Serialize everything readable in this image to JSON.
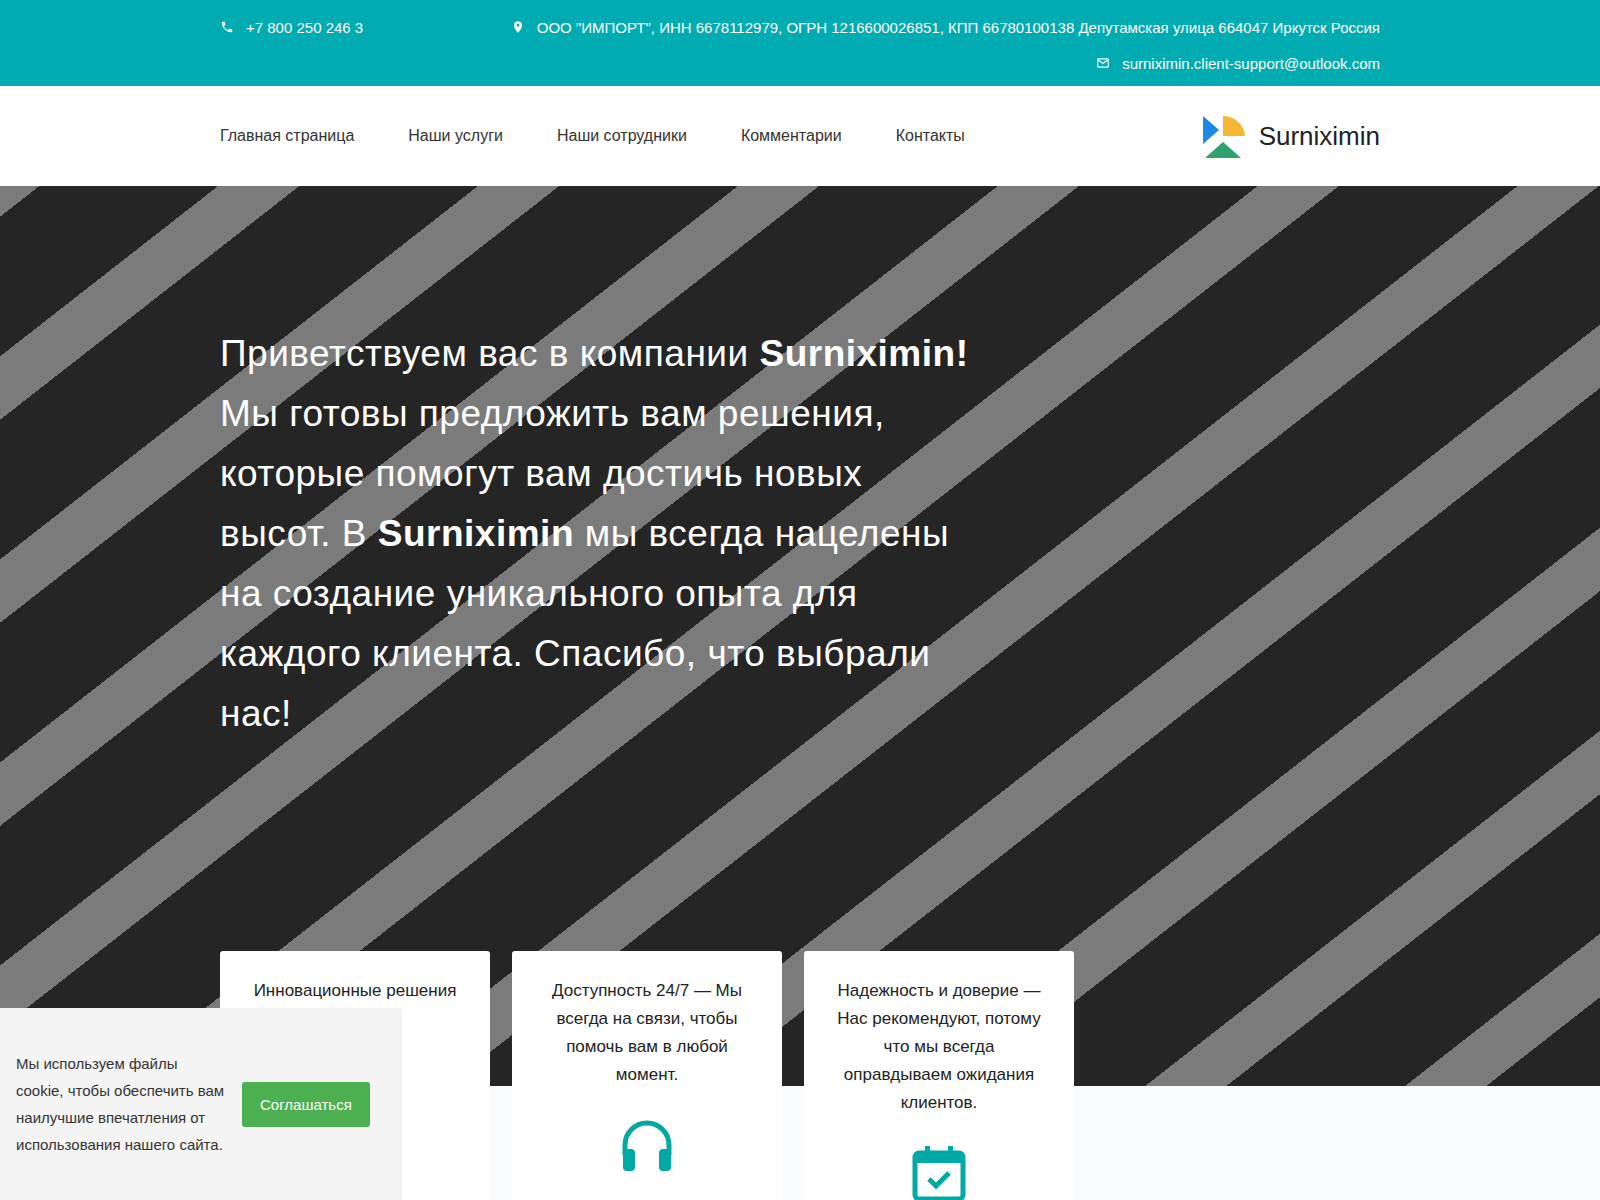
{
  "top_bar": {
    "phone": "+7 800 250 246 3",
    "address": "ООО \"ИМПОРТ\", ИНН 6678112979, ОГРН 1216600026851, КПП 66780100138 Депутамская улица 664047 Иркутск Россия",
    "email": "surniximin.client-support@outlook.com"
  },
  "nav": {
    "items": [
      {
        "label": "Главная страница",
        "selected": false
      },
      {
        "label": "Наши услуги",
        "selected": false
      },
      {
        "label": "Наши сотрудники",
        "selected": false
      },
      {
        "label": "Комментарии",
        "selected": false
      },
      {
        "label": "Контакты",
        "selected": false
      }
    ],
    "logo": "Surniximin"
  },
  "hero": {
    "segments": [
      {
        "text": "Приветствуем вас в компании ",
        "bold": false
      },
      {
        "text": "Surniximin!",
        "bold": true
      },
      {
        "text": " Мы готовы предложить вам решения, которые помогут вам достичь новых высот. В ",
        "bold": false
      },
      {
        "text": "Surniximin",
        "bold": true
      },
      {
        "text": " мы всегда нацелены на создание уникального опыта для каждого клиента. Спасибо, что выбрали нас!",
        "bold": false
      }
    ]
  },
  "features": [
    {
      "text": "Инновационные решения",
      "kind": "none"
    },
    {
      "text": "Доступность 24/7 — Мы всегда на связи, чтобы помочь вам в любой момент.",
      "kind": "headphones"
    },
    {
      "text": "Надежность и доверие — Нас рекомендуют, потому что мы всегда оправдываем ожидания клиентов.",
      "kind": "calendar"
    }
  ],
  "cookie_banner": {
    "text": "Мы используем файлы cookie, чтобы обеспечить вам наилучшие впечатления от использования нашего сайта.",
    "button": "Соглашаться"
  }
}
